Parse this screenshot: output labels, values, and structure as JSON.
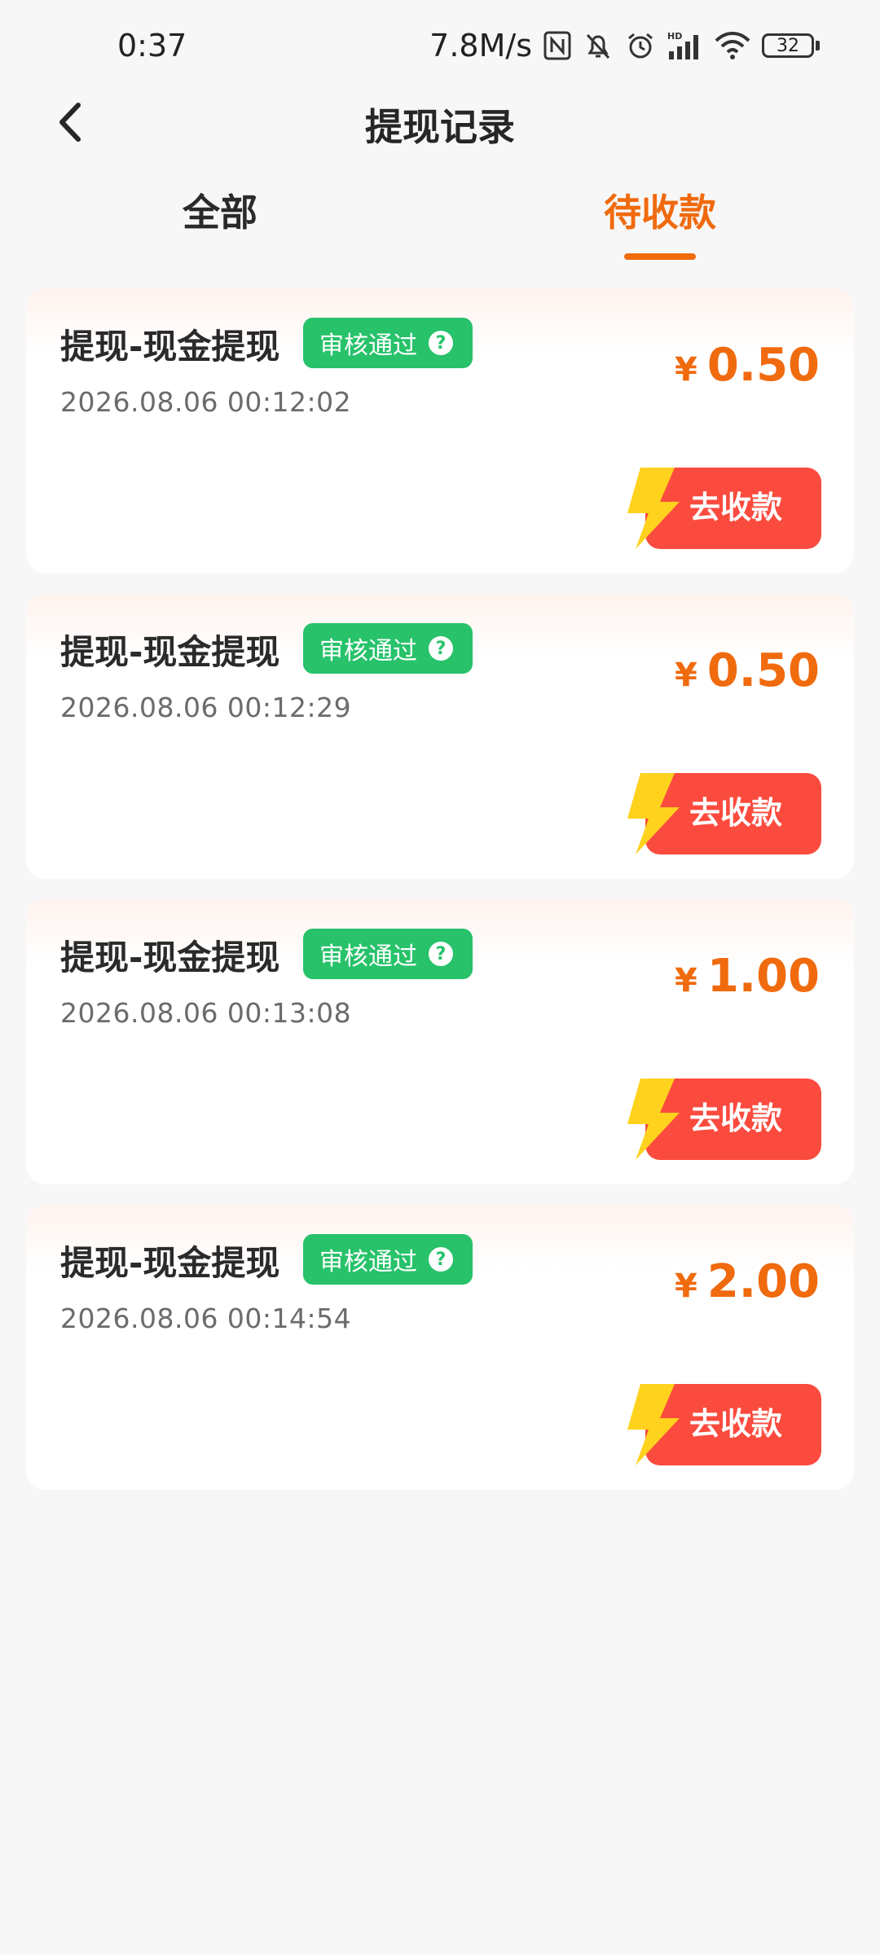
{
  "status": {
    "time": "0:37",
    "network_speed": "7.8M/s",
    "network_type": "HD",
    "battery": "32",
    "icons": [
      "nfc-icon",
      "mute-bell-icon",
      "alarm-icon",
      "signal-icon",
      "wifi-icon",
      "battery-icon"
    ]
  },
  "header": {
    "title": "提现记录",
    "back_icon": "chevron-left-icon"
  },
  "tabs": [
    {
      "label": "全部",
      "active": false
    },
    {
      "label": "待收款",
      "active": true
    }
  ],
  "colors": {
    "accent": "#f06a0e",
    "badge": "#27c26a",
    "button": "#fb4b3e",
    "bolt": "#ffd21e"
  },
  "records": [
    {
      "title": "提现-现金提现",
      "status": "审核通过",
      "help_icon": "?",
      "time": "2026.08.06 00:12:02",
      "currency": "¥",
      "amount": "0.50",
      "action": "去收款"
    },
    {
      "title": "提现-现金提现",
      "status": "审核通过",
      "help_icon": "?",
      "time": "2026.08.06 00:12:29",
      "currency": "¥",
      "amount": "0.50",
      "action": "去收款"
    },
    {
      "title": "提现-现金提现",
      "status": "审核通过",
      "help_icon": "?",
      "time": "2026.08.06 00:13:08",
      "currency": "¥",
      "amount": "1.00",
      "action": "去收款"
    },
    {
      "title": "提现-现金提现",
      "status": "审核通过",
      "help_icon": "?",
      "time": "2026.08.06 00:14:54",
      "currency": "¥",
      "amount": "2.00",
      "action": "去收款"
    }
  ]
}
